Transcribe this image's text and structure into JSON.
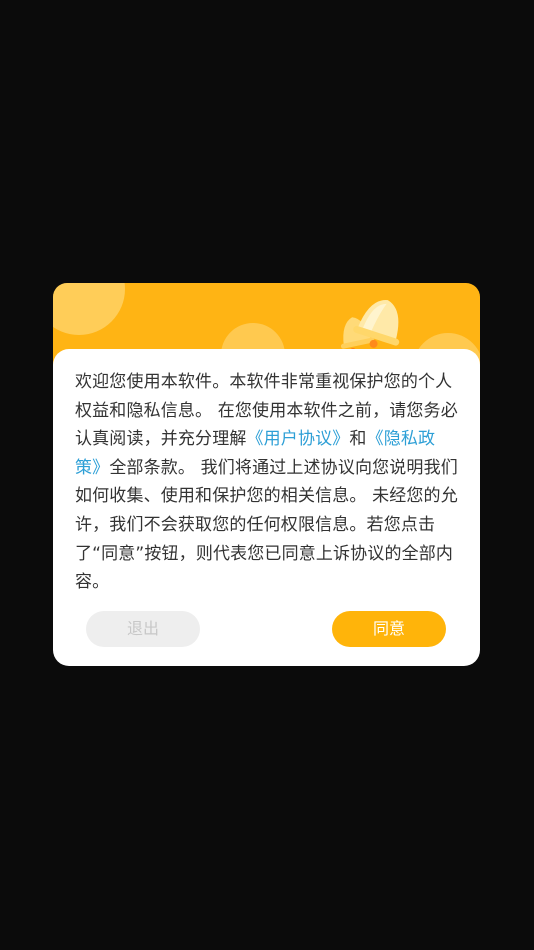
{
  "dialog": {
    "message_parts": {
      "p1": "欢迎您使用本软件。本软件非常重视保护您的个人权益和隐私信息。 在您使用本软件之前，请您务必认真阅读，并充分理解",
      "link_user_agreement": "《用户协议》",
      "p2": "和",
      "link_privacy_policy": "《隐私政策》",
      "p3": "全部条款。 我们将通过上述协议向您说明我们如何收集、使用和保护您的相关信息。 未经您的允许，我们不会获取您的任何权限信息。若您点击了“同意”按钮，则代表您已同意上诉协议的全部内容。"
    },
    "buttons": {
      "exit_label": "退出",
      "agree_label": "同意"
    },
    "icons": {
      "header_icon": "bell-icon"
    },
    "colors": {
      "accent": "#ffb414",
      "link": "#2d9fd6",
      "exit_button_bg": "#eeeeee",
      "exit_button_text": "#c8c8c8",
      "overlay": "#0b0b0b"
    }
  }
}
